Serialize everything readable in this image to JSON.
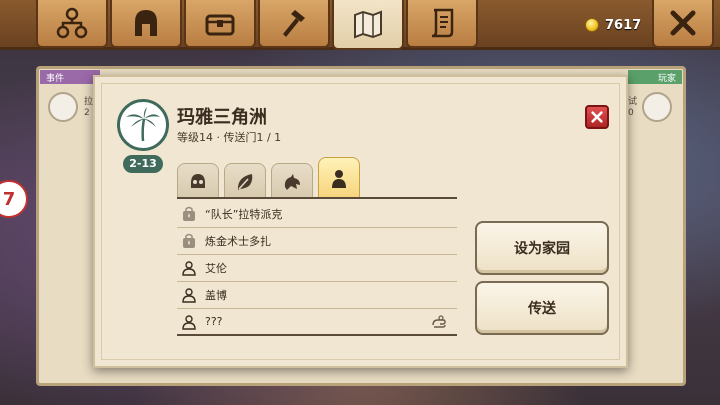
{
  "header": {
    "tabs": [
      {
        "name": "tab-network",
        "icon": "network-icon",
        "active": false
      },
      {
        "name": "tab-helmet",
        "icon": "helmet-icon",
        "active": false
      },
      {
        "name": "tab-chest",
        "icon": "chest-icon",
        "active": false
      },
      {
        "name": "tab-hammer",
        "icon": "hammer-icon",
        "active": false
      },
      {
        "name": "tab-map",
        "icon": "map-icon",
        "active": true
      },
      {
        "name": "tab-scroll",
        "icon": "scroll-icon",
        "active": false
      }
    ],
    "coins": "7617",
    "close_icon": "close-x-icon"
  },
  "background": {
    "left_strip": "事件",
    "right_strip": "玩家",
    "left_text_1": "拉",
    "left_text_2": "2",
    "right_text_1": "试",
    "right_text_2": "0",
    "side_badge": "7"
  },
  "dialog": {
    "region_icon": "palm-tree-icon",
    "region_badge": "2-13",
    "title": "玛雅三角洲",
    "subtitle": "等级14 · 传送门1 / 1",
    "close_icon": "close-x-icon",
    "category_tabs": [
      {
        "icon": "skull-icon",
        "active": false
      },
      {
        "icon": "leaf-icon",
        "active": false
      },
      {
        "icon": "creature-icon",
        "active": false
      },
      {
        "icon": "person-icon",
        "active": true
      }
    ],
    "list": [
      {
        "label": "“队长”拉特派克",
        "icon": "locked-bag-icon"
      },
      {
        "label": "炼金术士多扎",
        "icon": "locked-bag-icon"
      },
      {
        "label": "艾伦",
        "icon": "person-outline-icon"
      },
      {
        "label": "盖博",
        "icon": "person-outline-icon"
      },
      {
        "label": "???",
        "icon": "person-outline-icon",
        "extra_icon": "hand-icon"
      }
    ],
    "buttons": {
      "set_home": "设为家园",
      "teleport": "传送"
    }
  },
  "colors": {
    "accent": "#3f6a5c",
    "close_red": "#c23030",
    "parchment": "#f0e6d2",
    "wood": "#b97d42"
  }
}
